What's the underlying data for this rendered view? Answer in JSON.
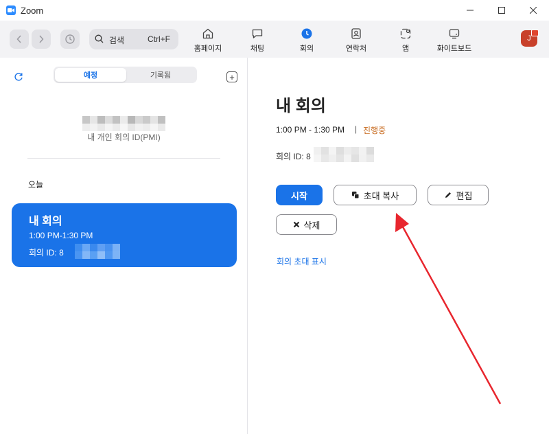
{
  "window": {
    "title": "Zoom",
    "minimize_glyph": "—",
    "maximize_glyph": "☐",
    "close_glyph": "✕"
  },
  "toolbar": {
    "search_label": "검색",
    "search_shortcut": "Ctrl+F",
    "tabs": [
      {
        "label": "홈페이지",
        "icon": "home-icon"
      },
      {
        "label": "채팅",
        "icon": "chat-icon"
      },
      {
        "label": "회의",
        "icon": "clock-icon",
        "active": true
      },
      {
        "label": "연락처",
        "icon": "contacts-icon"
      },
      {
        "label": "앱",
        "icon": "apps-icon"
      },
      {
        "label": "화이트보드",
        "icon": "whiteboard-icon"
      }
    ],
    "avatar_initial": "J"
  },
  "left": {
    "segment": {
      "scheduled": "예정",
      "recorded": "기록됨"
    },
    "pmi_label": "내 개인 회의 ID(PMI)",
    "today_label": "오늘",
    "meeting_card": {
      "title": "내 회의",
      "time": "1:00 PM-1:30 PM",
      "id_prefix": "회의 ID: 8"
    }
  },
  "right": {
    "title": "내 회의",
    "time": "1:00 PM - 1:30 PM",
    "separator": "|",
    "status": "진행중",
    "id_prefix": "회의 ID: 8",
    "buttons": {
      "start": "시작",
      "copy_invite": "초대 복사",
      "edit": "편집",
      "delete": "삭제"
    },
    "show_invite_link": "회의 초대 표시"
  },
  "colors": {
    "accent": "#1a73e8",
    "status": "#c86b1f",
    "annotation_arrow": "#e8262e",
    "avatar": "#c8402a"
  }
}
